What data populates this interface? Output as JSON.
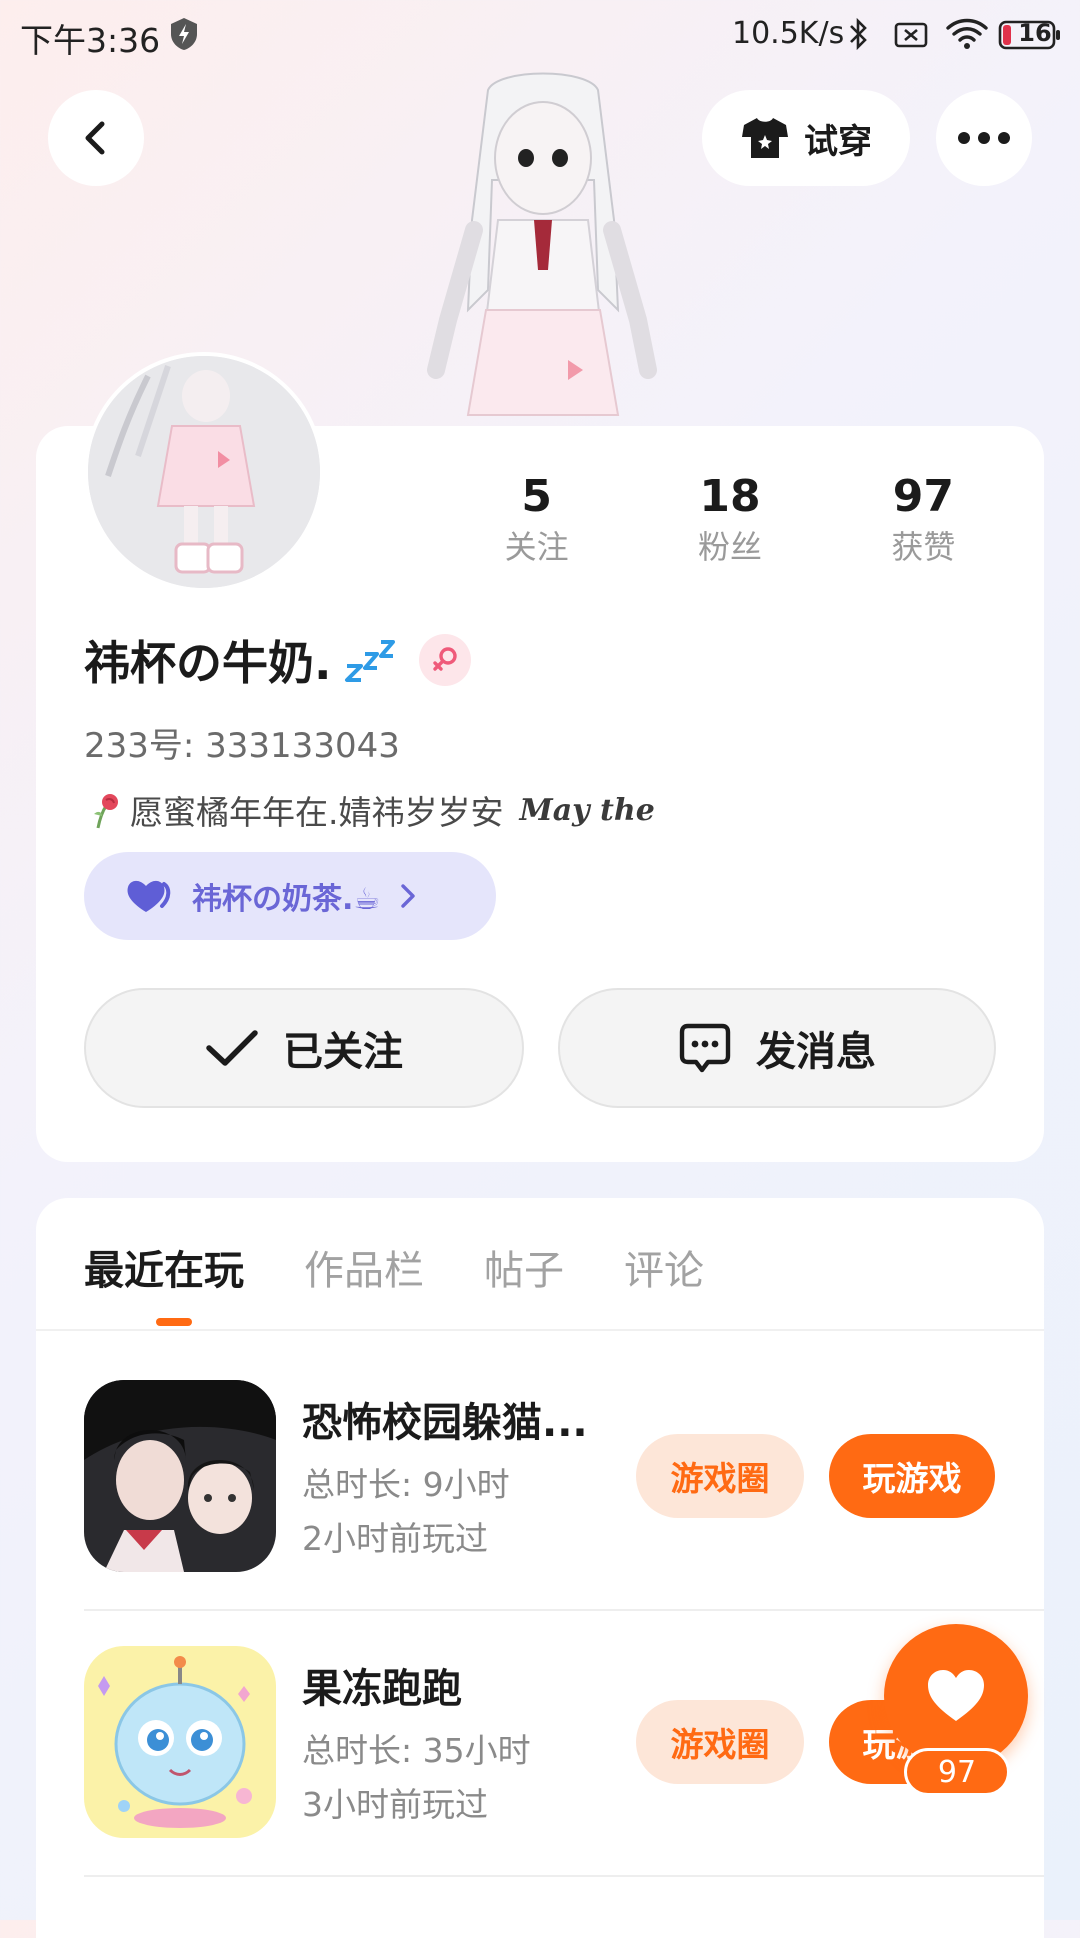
{
  "status_bar": {
    "time": "下午3:36",
    "net_speed": "10.5K/s",
    "battery": "16"
  },
  "header": {
    "try_on_label": "试穿"
  },
  "stats": [
    {
      "value": "5",
      "label": "关注"
    },
    {
      "value": "18",
      "label": "粉丝"
    },
    {
      "value": "97",
      "label": "获赞"
    }
  ],
  "profile": {
    "nickname": "祎杯の牛奶.",
    "uid": "233号: 333133043",
    "bio": "愿蜜橘年年在.婧祎岁岁安",
    "bio_en": "May the",
    "cp_tag": "祎杯の奶茶.☕"
  },
  "actions": {
    "follow_label": "已关注",
    "message_label": "发消息"
  },
  "tabs": [
    "最近在玩",
    "作品栏",
    "帖子",
    "评论"
  ],
  "games": [
    {
      "name": "恐怖校园躲猫...",
      "duration": "总时长: 9小时",
      "last_played": "2小时前玩过",
      "circle_label": "游戏圈",
      "play_label": "玩游戏"
    },
    {
      "name": "果冻跑跑",
      "duration": "总时长: 35小时",
      "last_played": "3小时前玩过",
      "circle_label": "游戏圈",
      "play_label": "玩游戏"
    }
  ],
  "like_count": "97",
  "colors": {
    "accent": "#ff6a13",
    "cp_tag_bg": "#e5e5fb",
    "cp_tag_text": "#6a66d6"
  }
}
